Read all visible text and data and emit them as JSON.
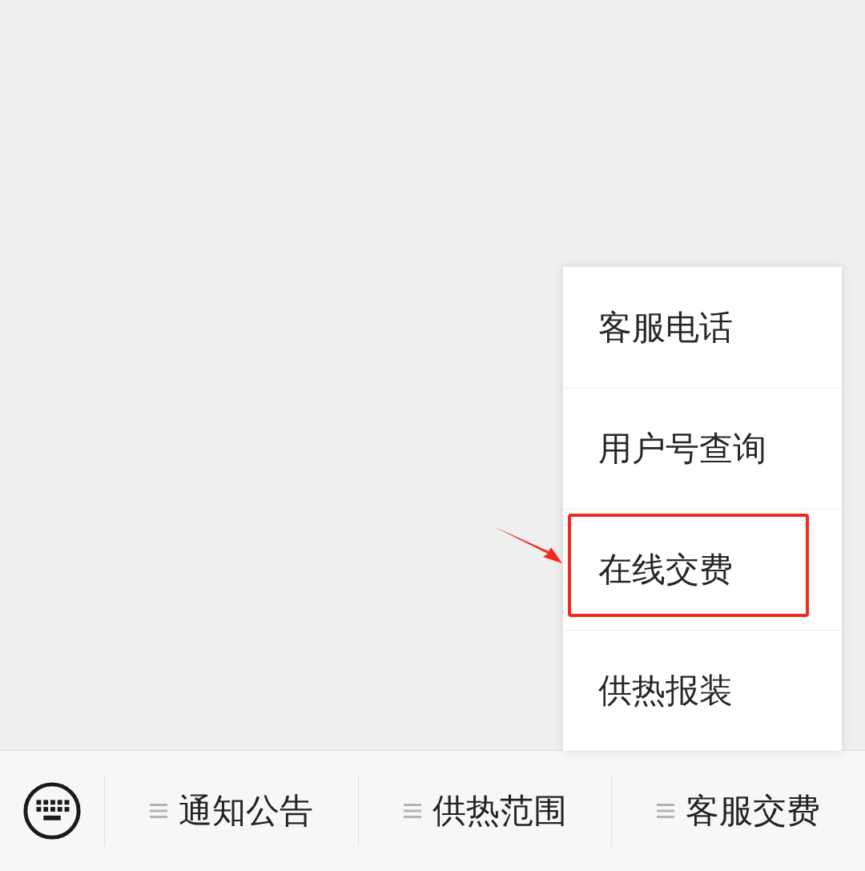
{
  "popup_menu": {
    "items": [
      {
        "label": "客服电话",
        "highlighted": false
      },
      {
        "label": "用户号查询",
        "highlighted": false
      },
      {
        "label": "在线交费",
        "highlighted": true
      },
      {
        "label": "供热报装",
        "highlighted": false
      }
    ]
  },
  "bottom_menu": {
    "tabs": [
      {
        "label": "通知公告"
      },
      {
        "label": "供热范围"
      },
      {
        "label": "客服交费"
      }
    ]
  }
}
